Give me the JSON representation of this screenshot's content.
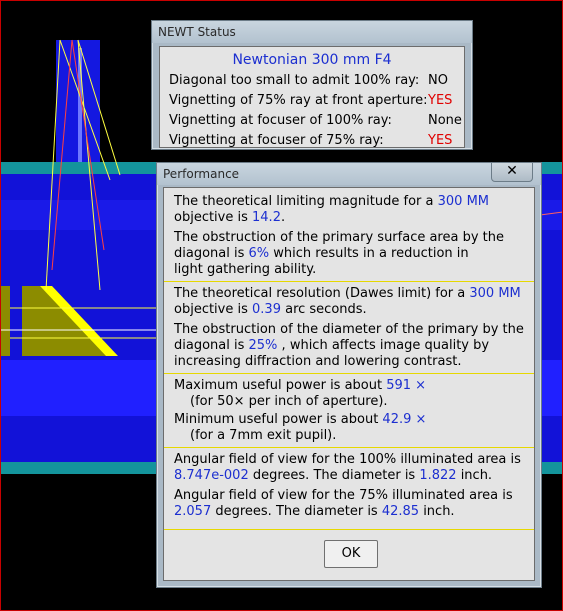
{
  "colors": {
    "accent_blue": "#1c2fd0",
    "warning_red": "#e00000",
    "separator_yellow": "#e6d800"
  },
  "status_window": {
    "title": "NEWT Status",
    "heading": "Newtonian 300 mm F4",
    "rows": [
      {
        "label": "Diagonal too small to admit 100% ray:",
        "value": "NO"
      },
      {
        "label": "Vignetting of 75% ray at front aperture:",
        "value": "YES"
      },
      {
        "label": "Vignetting at focuser of 100% ray:",
        "value": "None"
      },
      {
        "label": "Vignetting at focuser of 75% ray:",
        "value": "YES"
      }
    ]
  },
  "performance_window": {
    "title": "Performance",
    "close_icon": "close-icon",
    "limiting_magnitude": {
      "text1": "The theoretical limiting magnitude for a ",
      "aperture": "300 MM",
      "text2": "objective is ",
      "value": "14.2",
      "text3": "."
    },
    "obstruction_area": {
      "text1": "The obstruction of the primary surface area by the",
      "text2": "diagonal is ",
      "value": "6%",
      "text3": " which results in a reduction in",
      "text4": "light gathering ability."
    },
    "resolution": {
      "text1": "The theoretical resolution (Dawes limit) for a ",
      "aperture": "300 MM",
      "text2": "objective is ",
      "value": "0.39",
      "text3": " arc seconds."
    },
    "obstruction_diameter": {
      "text1": "The obstruction of the diameter of the primary by the",
      "text2": "diagonal is ",
      "value": "25%",
      "text3": " , which affects image quality by",
      "text4": "increasing diffraction and lowering contrast."
    },
    "max_power": {
      "text1": "Maximum useful power is about ",
      "value": "591 ×",
      "note": "(for 50× per inch of aperture)."
    },
    "min_power": {
      "text1": "Minimum useful power is about ",
      "value": "42.9 ×",
      "note": "(for a 7mm exit pupil)."
    },
    "fov_100": {
      "text1": "Angular field of view for the 100% illuminated area is",
      "degrees": "8.747e-002",
      "text2": " degrees.  The diameter is ",
      "diameter": "1.822",
      "text3": " inch."
    },
    "fov_75": {
      "text1": "Angular field of view for the 75% illuminated area is",
      "degrees": "2.057",
      "text2": " degrees.  The diameter is ",
      "diameter": "42.85",
      "text3": " inch."
    },
    "ok_label": "OK"
  }
}
